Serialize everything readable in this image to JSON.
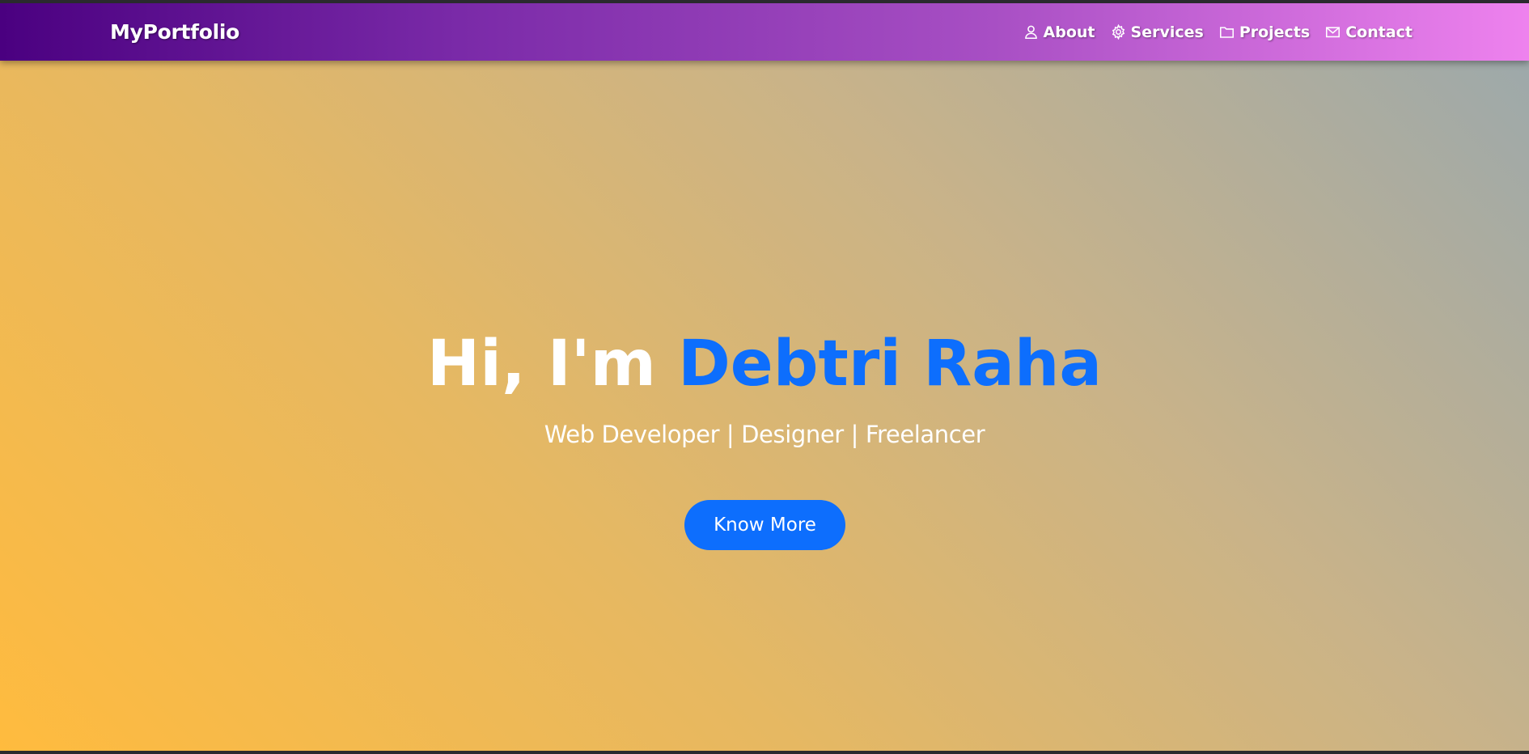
{
  "brand": "MyPortfolio",
  "nav": {
    "items": [
      {
        "label": "About",
        "icon": "person-icon"
      },
      {
        "label": "Services",
        "icon": "gear-icon"
      },
      {
        "label": "Projects",
        "icon": "folder-icon"
      },
      {
        "label": "Contact",
        "icon": "envelope-icon"
      }
    ]
  },
  "hero": {
    "greeting": "Hi, I'm",
    "name": "Debtri Raha",
    "subtitle": "Web Developer | Designer | Freelancer",
    "button_label": "Know More"
  },
  "colors": {
    "accent": "#0d6efd",
    "nav_gradient_start": "#4a0080",
    "nav_gradient_end": "#ee82ee",
    "hero_gradient_start": "#ffbb3e",
    "hero_gradient_end": "#9aa8ad"
  }
}
